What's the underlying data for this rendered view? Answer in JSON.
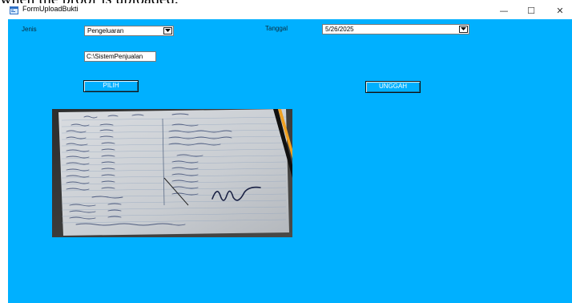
{
  "top_caption": "when the proof is uploaded.",
  "window": {
    "title": "FormUploadBukti",
    "minimize": "—",
    "maximize": "☐",
    "close": "✕"
  },
  "form": {
    "jenis_label": "Jenis",
    "jenis_value": "Pengeluaran",
    "tanggal_label": "Tanggal",
    "tanggal_value": "5/26/2025",
    "path_value": "C:\\SistemPenjualan",
    "pilih_button": "PILIH",
    "unggah_button": "UNGGAH"
  },
  "colors": {
    "form_background": "#00b0ff",
    "titlebar": "#ffffff"
  },
  "icons": [
    "app-form-icon",
    "chevron-down-icon"
  ]
}
